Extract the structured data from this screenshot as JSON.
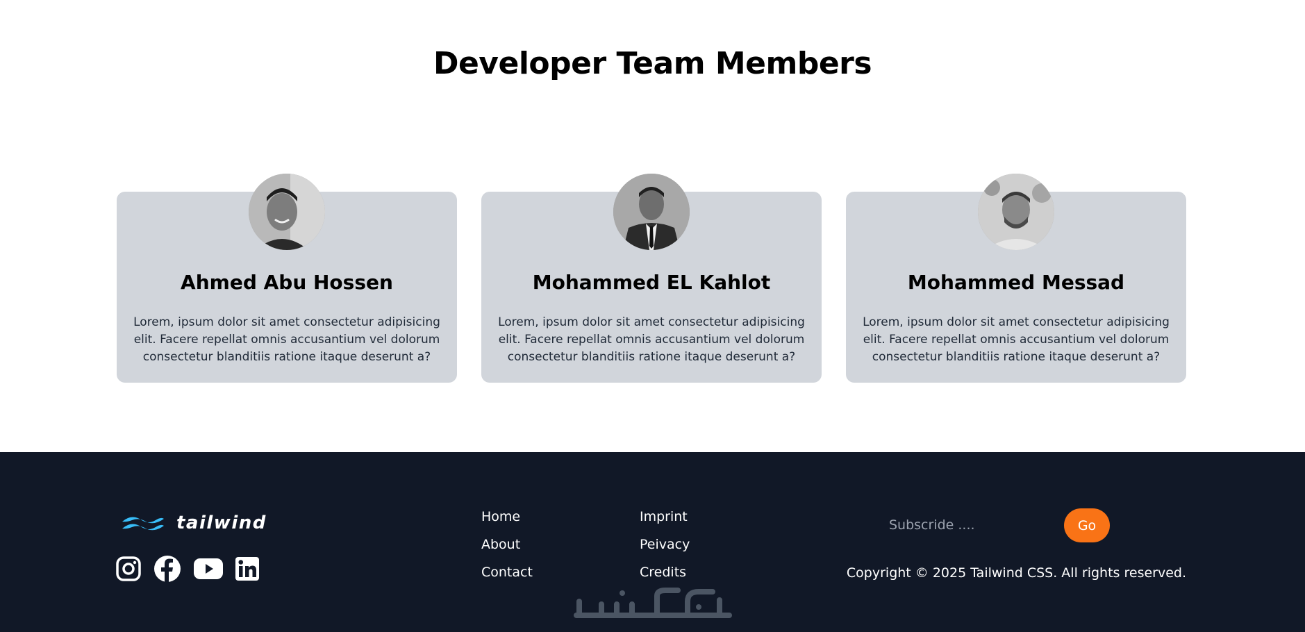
{
  "team": {
    "title": "Developer Team Members",
    "members": [
      {
        "name": "Ahmed Abu Hossen",
        "bio": "Lorem, ipsum dolor sit amet consectetur adipisicing elit. Facere repellat omnis accusantium vel dolorum consectetur blanditiis ratione itaque deserunt a?"
      },
      {
        "name": "Mohammed EL Kahlot",
        "bio": "Lorem, ipsum dolor sit amet consectetur adipisicing elit. Facere repellat omnis accusantium vel dolorum consectetur blanditiis ratione itaque deserunt a?"
      },
      {
        "name": "Mohammed Messad",
        "bio": "Lorem, ipsum dolor sit amet consectetur adipisicing elit. Facere repellat omnis accusantium vel dolorum consectetur blanditiis ratione itaque deserunt a?"
      }
    ]
  },
  "footer": {
    "logo_text": "tailwind",
    "logo_color": "#38bdf8",
    "socials": [
      "instagram-icon",
      "facebook-icon",
      "youtube-icon",
      "linkedin-icon"
    ],
    "links_col1": [
      "Home",
      "About",
      "Contact"
    ],
    "links_col2": [
      "Imprint",
      "Peivacy",
      "Credits"
    ],
    "subscribe_placeholder": "Subscride ....",
    "go_label": "Go",
    "go_color": "#f97316",
    "copyright": "Copyright © 2025 Tailwind CSS. All rights reserved.",
    "background": "#111827",
    "watermark": "خمسات"
  }
}
